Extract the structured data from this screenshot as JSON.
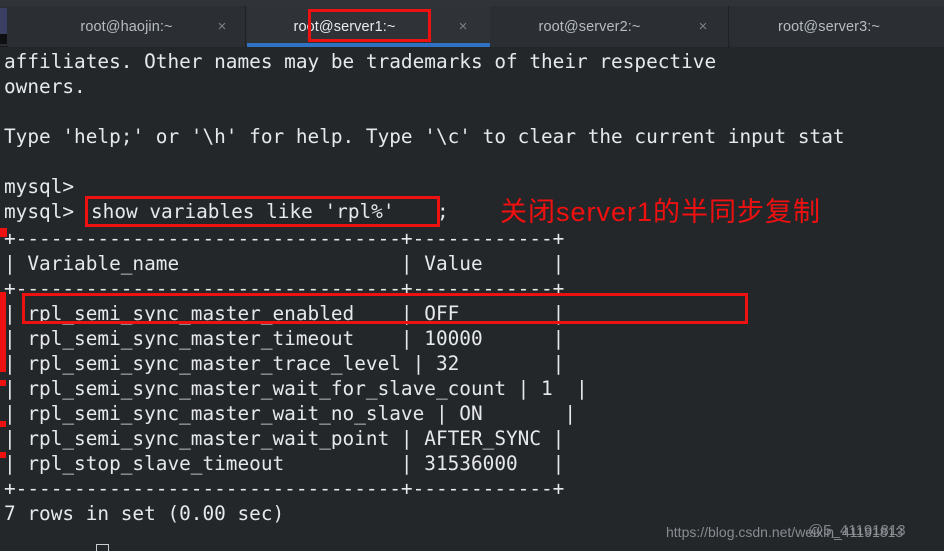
{
  "window": {
    "tabs": [
      {
        "label": "root@haojin:~",
        "active": false,
        "has_close": true
      },
      {
        "label": "root@server1:~",
        "active": true,
        "has_close": true
      },
      {
        "label": "root@server2:~",
        "active": false,
        "has_close": true
      },
      {
        "label": "root@server3:~",
        "active": false,
        "has_close": false
      }
    ],
    "close_icon_glyph": "×"
  },
  "terminal": {
    "lines": [
      "affiliates. Other names may be trademarks of their respective",
      "owners.",
      "",
      "Type 'help;' or '\\h' for help. Type '\\c' to clear the current input stat",
      "",
      "mysql>",
      "mysql> show variables like 'rpl%';",
      "+---------------------------------+------------+",
      "| Variable_name                   | Value      |",
      "+---------------------------------+------------+",
      "| rpl_semi_sync_master_enabled    | OFF        |",
      "| rpl_semi_sync_master_timeout    | 10000      |",
      "| rpl_semi_sync_master_trace_level | 32        |",
      "| rpl_semi_sync_master_wait_for_slave_count | 1  |",
      "| rpl_semi_sync_master_wait_no_slave | ON       |",
      "| rpl_semi_sync_master_wait_point | AFTER_SYNC |",
      "| rpl_stop_slave_timeout          | 31536000   |",
      "+---------------------------------+------------+",
      "7 rows in set (0.00 sec)"
    ],
    "prompt": "mysql>",
    "command": "show variables like 'rpl%'",
    "command_terminator": ";",
    "result_table": {
      "columns": [
        "Variable_name",
        "Value"
      ],
      "rows": [
        {
          "name": "rpl_semi_sync_master_enabled",
          "value": "OFF",
          "highlighted": true
        },
        {
          "name": "rpl_semi_sync_master_timeout",
          "value": "10000",
          "highlighted": false
        },
        {
          "name": "rpl_semi_sync_master_trace_level",
          "value": "32",
          "highlighted": false
        },
        {
          "name": "rpl_semi_sync_master_wait_for_slave_count",
          "value": "1",
          "highlighted": false
        },
        {
          "name": "rpl_semi_sync_master_wait_no_slave",
          "value": "ON",
          "highlighted": false
        },
        {
          "name": "rpl_semi_sync_master_wait_point",
          "value": "AFTER_SYNC",
          "highlighted": false
        },
        {
          "name": "rpl_stop_slave_timeout",
          "value": "31536000",
          "highlighted": false
        }
      ]
    },
    "row_count_text": "7 rows in set (0.00 sec)"
  },
  "annotations": {
    "note_text": "关闭server1的半同步复制",
    "note_color": "#f01010",
    "highlight_color": "#ee1111"
  },
  "watermark": {
    "url": "https://blog.csdn.net/weixin_41191813",
    "overlay": "@5_41191813"
  }
}
